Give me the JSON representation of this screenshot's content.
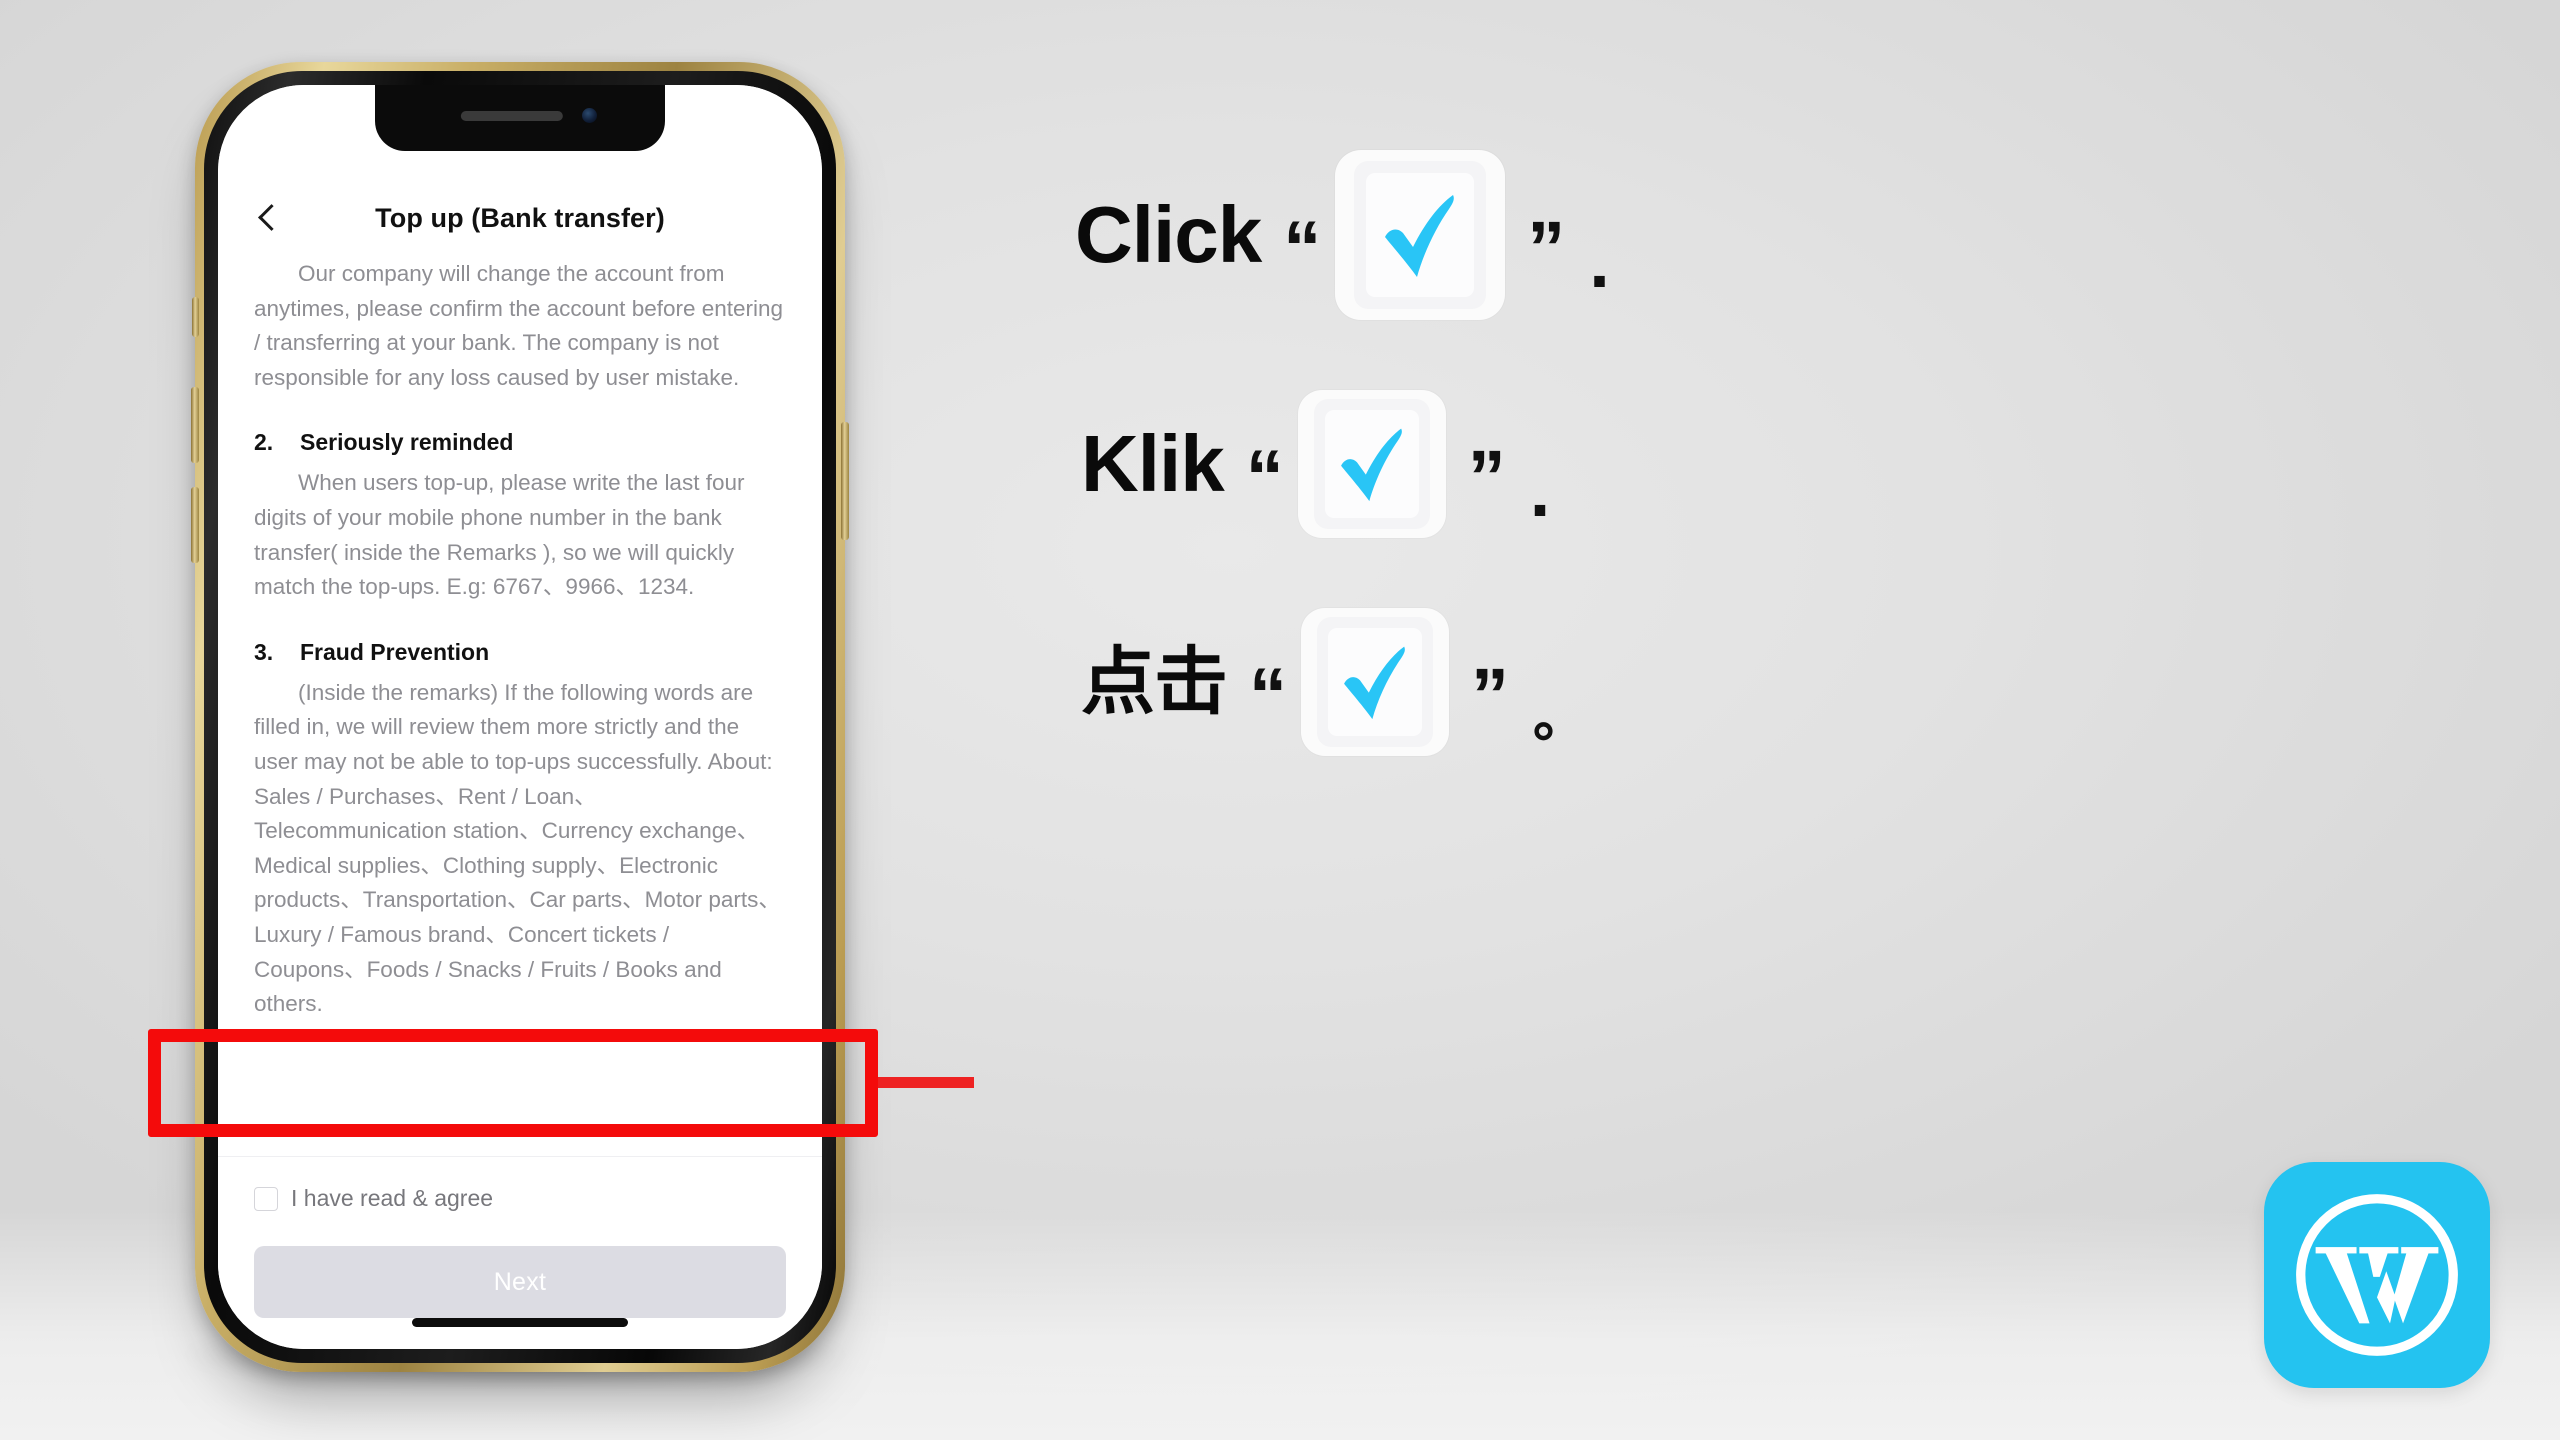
{
  "phone_app": {
    "appbar": {
      "back_icon": "chevron-left-icon",
      "title": "Top up (Bank transfer)"
    },
    "body": {
      "paragraph_1": "Our company will change the account from anytimes, please confirm the account before entering / transferring at your bank. The company is not responsible for any loss caused by user mistake.",
      "section_2": {
        "number": "2.",
        "title": "Seriously reminded"
      },
      "paragraph_2": "When users top-up, please write the last four digits of your mobile phone number in the bank transfer( inside the Remarks ), so we will quickly match the top-ups. E.g: 6767、9966、1234.",
      "section_3": {
        "number": "3.",
        "title": "Fraud Prevention"
      },
      "paragraph_3": "(Inside the remarks) If the following words are filled in, we will review them more strictly and the user may not be able to top-ups successfully. About: Sales / Purchases、Rent / Loan、Telecommunication station、Currency exchange、Medical supplies、Clothing supply、Electronic products、Transportation、Car parts、Motor parts、Luxury / Famous brand、Concert tickets / Coupons、Foods / Snacks / Fruits / Books and others."
    },
    "agree": {
      "checkbox_checked": false,
      "label": "I have read & agree"
    },
    "next_button": {
      "label": "Next",
      "enabled": false
    }
  },
  "annotation": {
    "box_color": "#f40b0b",
    "arrow_color": "#ee2222"
  },
  "instructions": [
    {
      "word": "Click",
      "quote_open": "“",
      "quote_close": "”",
      "trailing": ".",
      "icon": "white-check-mark-icon"
    },
    {
      "word": "Klik",
      "quote_open": "“",
      "quote_close": "”",
      "trailing": ".",
      "icon": "white-check-mark-icon"
    },
    {
      "word": "点击",
      "quote_open": "“",
      "quote_close": "”",
      "trailing": "。",
      "icon": "white-check-mark-icon"
    }
  ],
  "brand_logo": {
    "name": "wordpress-logo",
    "letter": "W",
    "color": "#24c3f0"
  },
  "colors": {
    "check_blue": "#29c5f6",
    "accent_red": "#f40b0b",
    "muted_text": "#8e8e93",
    "disabled_button": "#dcdce3"
  }
}
